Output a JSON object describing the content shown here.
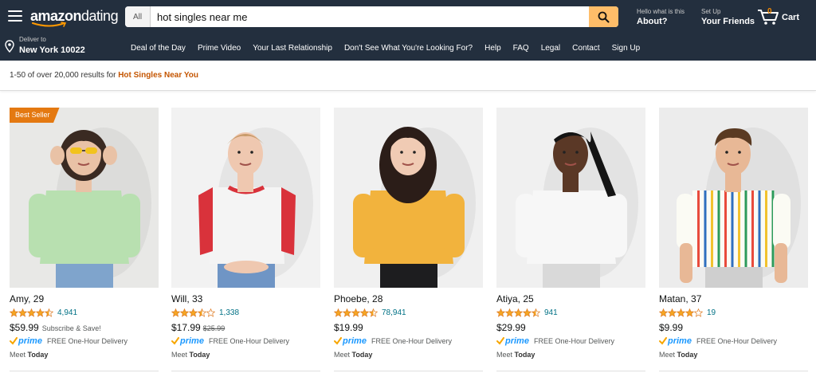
{
  "header": {
    "logo_brand": "amazon",
    "logo_suffix": "dating",
    "search": {
      "category": "All",
      "query": "hot singles near me"
    },
    "hello": {
      "small": "Hello what is this",
      "big": "About?"
    },
    "setup": {
      "small": "Set Up",
      "big": "Your Friends"
    },
    "cart": {
      "count": "0",
      "label": "Cart"
    }
  },
  "subnav": {
    "deliver_small": "Deliver to",
    "deliver_big": "New York 10022",
    "links": [
      "Deal of the Day",
      "Prime Video",
      "Your Last Relationship",
      "Don't See What You're Looking For?",
      "Help",
      "FAQ",
      "Legal",
      "Contact",
      "Sign Up"
    ]
  },
  "results": {
    "summary": "1-50 of over 20,000 results for",
    "query": "Hot Singles Near You"
  },
  "products": [
    {
      "badge": "Best Seller",
      "name": "Amy, 29",
      "rating": 4.5,
      "reviews": "4,941",
      "price": "$59.99",
      "old_price": "",
      "subscribe": "Subscribe & Save!",
      "prime": "prime",
      "delivery": "FREE One-Hour Delivery",
      "meet": "Meet",
      "meet_when": "Today",
      "photo": {
        "bg": "#e8e8e6",
        "top": "#b8e0b0",
        "skin": "#e9c2a6",
        "hair": "#3a2a22",
        "bottom": "#7fa4cc",
        "accessory": "sunglasses"
      }
    },
    {
      "badge": "",
      "name": "Will, 33",
      "rating": 3.5,
      "reviews": "1,338",
      "price": "$17.99",
      "old_price": "$25.99",
      "subscribe": "",
      "prime": "prime",
      "delivery": "FREE One-Hour Delivery",
      "meet": "Meet",
      "meet_when": "Today",
      "photo": {
        "bg": "#f2f2f2",
        "top": "#f4f4f4",
        "sleeve": "#d9323b",
        "skin": "#efc8b0",
        "hair": "#c89b6a",
        "bottom": "#6f95c5"
      }
    },
    {
      "badge": "",
      "name": "Phoebe, 28",
      "rating": 4.5,
      "reviews": "78,941",
      "price": "$19.99",
      "old_price": "",
      "subscribe": "",
      "prime": "prime",
      "delivery": "FREE One-Hour Delivery",
      "meet": "Meet",
      "meet_when": "Today",
      "photo": {
        "bg": "#f0f0f0",
        "top": "#f2b33d",
        "skin": "#f0cbb4",
        "hair": "#2b1d18",
        "bottom": "#1d1d1f"
      }
    },
    {
      "badge": "",
      "name": "Atiya, 25",
      "rating": 4.5,
      "reviews": "941",
      "price": "$29.99",
      "old_price": "",
      "subscribe": "",
      "prime": "prime",
      "delivery": "FREE One-Hour Delivery",
      "meet": "Meet",
      "meet_when": "Today",
      "photo": {
        "bg": "#f0f0f0",
        "top": "#f7f7f7",
        "skin": "#5a3826",
        "hair": "#141414",
        "bottom": "#d9d9d9"
      }
    },
    {
      "badge": "",
      "name": "Matan, 37",
      "rating": 4,
      "reviews": "19",
      "price": "$9.99",
      "old_price": "",
      "subscribe": "",
      "prime": "prime",
      "delivery": "FREE One-Hour Delivery",
      "meet": "Meet",
      "meet_when": "Today",
      "photo": {
        "bg": "#ececec",
        "top": "#fbfbf4",
        "stripes": [
          "#e84b3c",
          "#2f6fbf",
          "#f2c22e",
          "#2c9a5a"
        ],
        "skin": "#e8b896",
        "hair": "#5a3a22",
        "bottom": "#cfcfcf"
      }
    }
  ],
  "colors": {
    "header_bg": "#232f3e",
    "search_button": "#febd69",
    "accent_orange": "#c45500",
    "badge_orange": "#e47911",
    "link_teal": "#007185",
    "star": "#f5a623",
    "prime_blue": "#1a98ff"
  }
}
